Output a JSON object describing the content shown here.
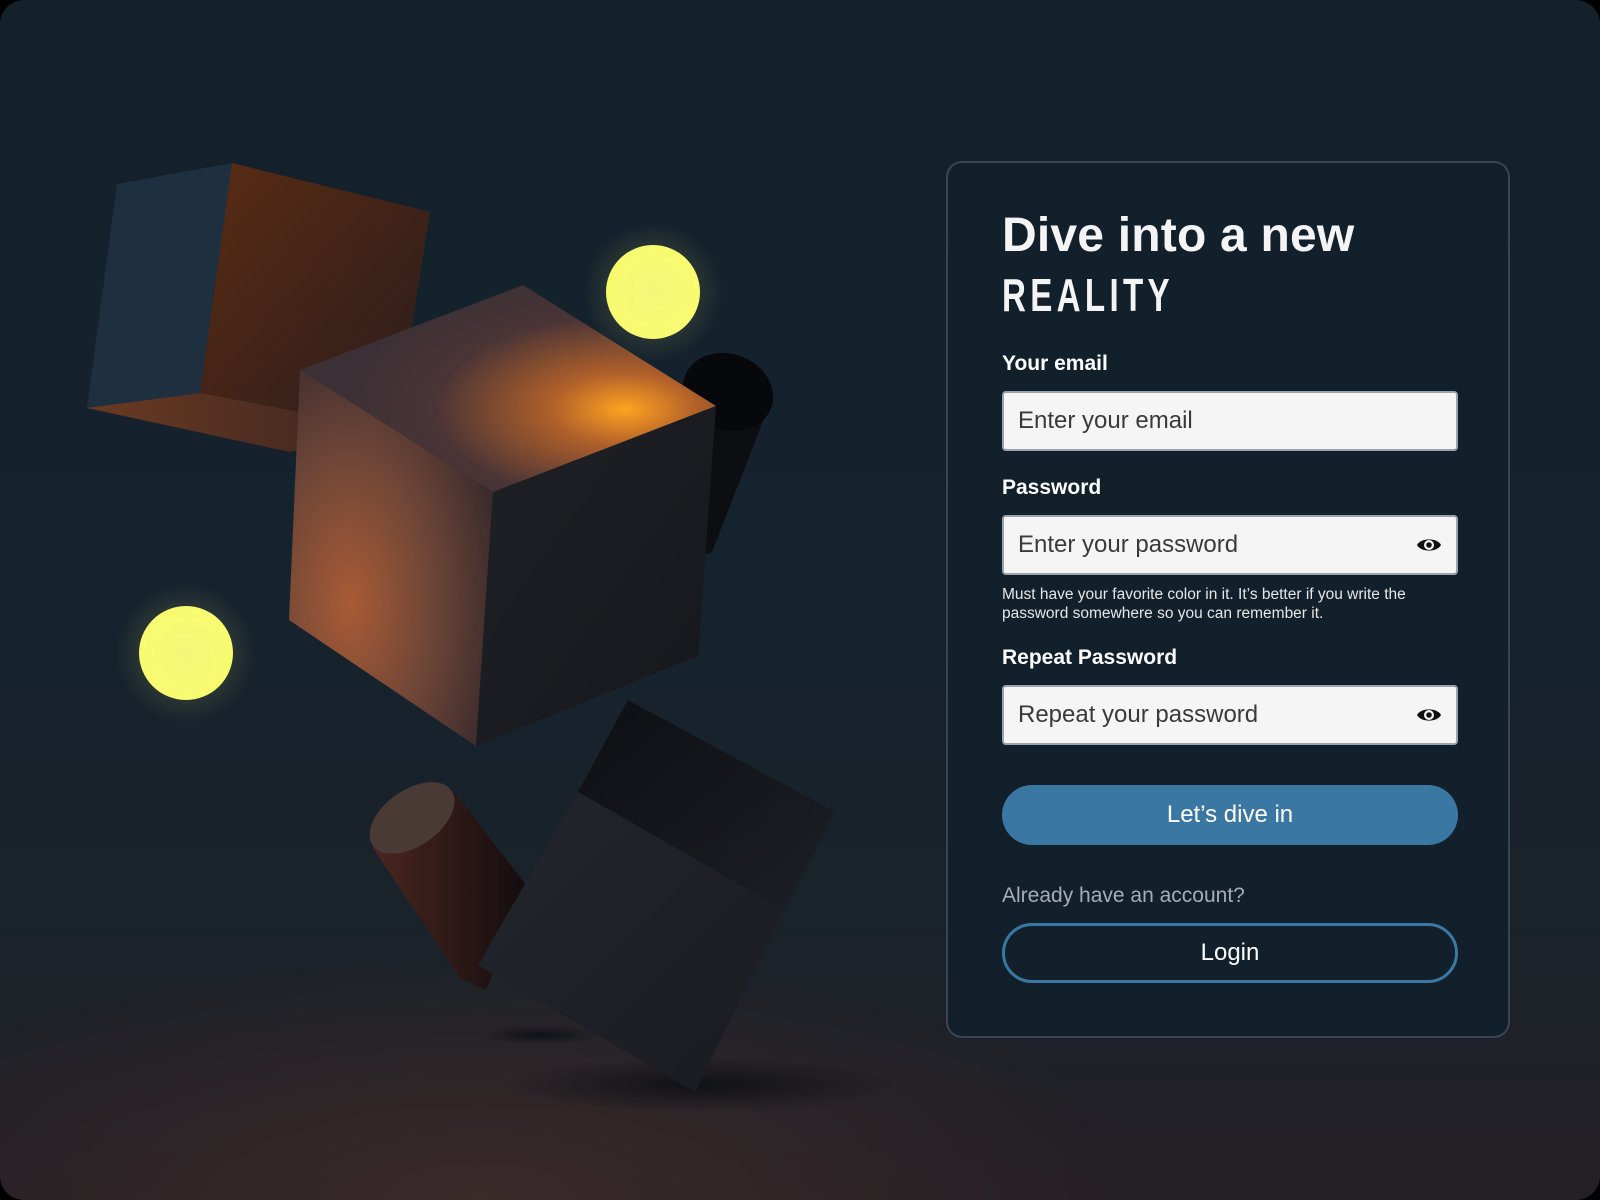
{
  "hero": {
    "title_line1": "Dive into a new",
    "title_line2": "REALITY"
  },
  "form": {
    "email": {
      "label": "Your email",
      "placeholder": "Enter your email",
      "value": ""
    },
    "password": {
      "label": "Password",
      "placeholder": "Enter your password",
      "value": "",
      "hint": "Must have your favorite color in it. It’s better if you write the password somewhere so you can remember it.",
      "toggle_icon": "eye-icon"
    },
    "repeat_password": {
      "label": "Repeat Password",
      "placeholder": "Repeat your password",
      "value": "",
      "toggle_icon": "eye-icon"
    },
    "submit_label": "Let’s dive in"
  },
  "login": {
    "prompt": "Already have an account?",
    "button_label": "Login"
  },
  "colors": {
    "accent": "#3a77a3",
    "card_background": "#12202b",
    "page_background": "#15232e",
    "orb": "#f8fb6f"
  }
}
